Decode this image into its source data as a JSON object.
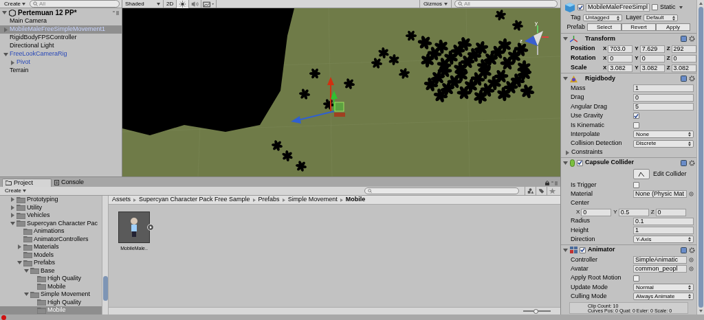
{
  "hierarchy": {
    "create_label": "Create",
    "search_placeholder": "All",
    "scene": {
      "name": "Pertemuan 12 PP*",
      "expanded": true
    },
    "items": [
      {
        "label": "Main Camera",
        "prefab": false,
        "selected": false
      },
      {
        "label": "MobileMaleFreeSimpleMovement1",
        "prefab": true,
        "selected": true,
        "expanded": false
      },
      {
        "label": "RigidBodyFPSController",
        "prefab": false,
        "selected": false
      },
      {
        "label": "Directional Light",
        "prefab": false,
        "selected": false
      },
      {
        "label": "FreeLookCameraRig",
        "prefab": true,
        "selected": false,
        "expanded": true,
        "children": [
          {
            "label": "Pivot",
            "prefab": true,
            "selected": false,
            "expanded": false
          }
        ]
      },
      {
        "label": "Terrain",
        "prefab": false,
        "selected": false
      }
    ]
  },
  "scene_toolbar": {
    "shading": "Shaded",
    "mode_2d": "2D",
    "gizmos": "Gizmos",
    "search_placeholder": "All"
  },
  "scene_view": {
    "gizmo_labels": [
      "y",
      "z"
    ]
  },
  "project": {
    "tabs": [
      {
        "label": "Project",
        "selected": true
      },
      {
        "label": "Console",
        "selected": false
      }
    ],
    "create_label": "Create",
    "tree": [
      {
        "label": "Prototyping",
        "selected": false,
        "expanded": false
      },
      {
        "label": "Utility",
        "selected": false,
        "expanded": false
      },
      {
        "label": "Vehicles",
        "selected": false,
        "expanded": false
      },
      {
        "label": "Supercyan Character Pac",
        "selected": false,
        "expanded": true,
        "children": [
          {
            "label": "Animations",
            "selected": false
          },
          {
            "label": "AnimatorControllers",
            "selected": false
          },
          {
            "label": "Materials",
            "selected": false,
            "expanded": false
          },
          {
            "label": "Models",
            "selected": false
          },
          {
            "label": "Prefabs",
            "selected": false,
            "expanded": true,
            "children": [
              {
                "label": "Base",
                "selected": false,
                "expanded": true,
                "children": [
                  {
                    "label": "High Quality",
                    "selected": false
                  },
                  {
                    "label": "Mobile",
                    "selected": false
                  }
                ]
              },
              {
                "label": "Simple Movement",
                "selected": false,
                "expanded": true,
                "children": [
                  {
                    "label": "High Quality",
                    "selected": false
                  },
                  {
                    "label": "Mobile",
                    "selected": true
                  }
                ]
              }
            ]
          }
        ]
      }
    ],
    "breadcrumb": [
      "Assets",
      "Supercyan Character Pack Free Sample",
      "Prefabs",
      "Simple Movement",
      "Mobile"
    ],
    "assets": [
      {
        "label": "MobileMale.."
      }
    ],
    "zoom_slider": {
      "level": 0.45
    }
  },
  "inspector": {
    "object": {
      "active": true,
      "name": "MobileMaleFreeSimpl",
      "static_label": "Static",
      "static": false,
      "tag_label": "Tag",
      "tag": "Untagged",
      "layer_label": "Layer",
      "layer": "Default",
      "prefab_label": "Prefab",
      "prefab_buttons": [
        "Select",
        "Revert",
        "Apply"
      ]
    },
    "components": [
      {
        "kind": "transform",
        "title": "Transform",
        "expanded": true,
        "fields": [
          {
            "kind": "vector",
            "label": "Position",
            "values": [
              {
                "axis": "X",
                "value": "703.0"
              },
              {
                "axis": "Y",
                "value": "7.629"
              },
              {
                "axis": "Z",
                "value": "292"
              }
            ]
          },
          {
            "kind": "vector",
            "label": "Rotation",
            "values": [
              {
                "axis": "X",
                "value": "0"
              },
              {
                "axis": "Y",
                "value": "0"
              },
              {
                "axis": "Z",
                "value": "0"
              }
            ]
          },
          {
            "kind": "vector",
            "label": "Scale",
            "values": [
              {
                "axis": "X",
                "value": "3.082"
              },
              {
                "axis": "Y",
                "value": "3.082"
              },
              {
                "axis": "Z",
                "value": "3.082"
              }
            ]
          }
        ]
      },
      {
        "kind": "rigidbody",
        "title": "Rigidbody",
        "expanded": true,
        "fields": [
          {
            "kind": "text",
            "label": "Mass",
            "value": "1"
          },
          {
            "kind": "text",
            "label": "Drag",
            "value": "0"
          },
          {
            "kind": "text",
            "label": "Angular Drag",
            "value": "5"
          },
          {
            "kind": "checkbox",
            "label": "Use Gravity",
            "checked": true
          },
          {
            "kind": "checkbox",
            "label": "Is Kinematic",
            "checked": false
          },
          {
            "kind": "dropdown",
            "label": "Interpolate",
            "value": "None"
          },
          {
            "kind": "dropdown",
            "label": "Collision Detection",
            "value": "Discrete"
          },
          {
            "kind": "foldout",
            "label": "Constraints",
            "expanded": false
          }
        ]
      },
      {
        "kind": "collider",
        "title": "Capsule Collider",
        "enabled": true,
        "expanded": true,
        "fields": [
          {
            "kind": "button",
            "label": "Edit Collider",
            "on": false
          },
          {
            "kind": "checkbox",
            "label": "Is Trigger",
            "checked": false
          },
          {
            "kind": "object",
            "label": "Material",
            "value": "None (Physic Mat"
          },
          {
            "kind": "heading",
            "label": "Center"
          },
          {
            "kind": "subvector",
            "values": [
              {
                "axis": "X",
                "value": "0"
              },
              {
                "axis": "Y",
                "value": "0.5"
              },
              {
                "axis": "Z",
                "value": "0"
              }
            ]
          },
          {
            "kind": "text",
            "label": "Radius",
            "value": "0.1"
          },
          {
            "kind": "text",
            "label": "Height",
            "value": "1"
          },
          {
            "kind": "dropdown",
            "label": "Direction",
            "value": "Y-Axis"
          }
        ]
      },
      {
        "kind": "animator",
        "title": "Animator",
        "enabled": true,
        "expanded": true,
        "fields": [
          {
            "kind": "object",
            "label": "Controller",
            "value": "SimpleAnimatic"
          },
          {
            "kind": "object",
            "label": "Avatar",
            "value": "common_peopl"
          },
          {
            "kind": "checkbox",
            "label": "Apply Root Motion",
            "checked": false
          },
          {
            "kind": "dropdown",
            "label": "Update Mode",
            "value": "Normal"
          },
          {
            "kind": "dropdown",
            "label": "Culling Mode",
            "value": "Always Animate"
          },
          {
            "kind": "info",
            "lines": [
              "Clip Count: 10",
              "Curves Pos: 0 Quat: 0 Euler: 0 Scale: 0"
            ]
          }
        ]
      }
    ]
  }
}
